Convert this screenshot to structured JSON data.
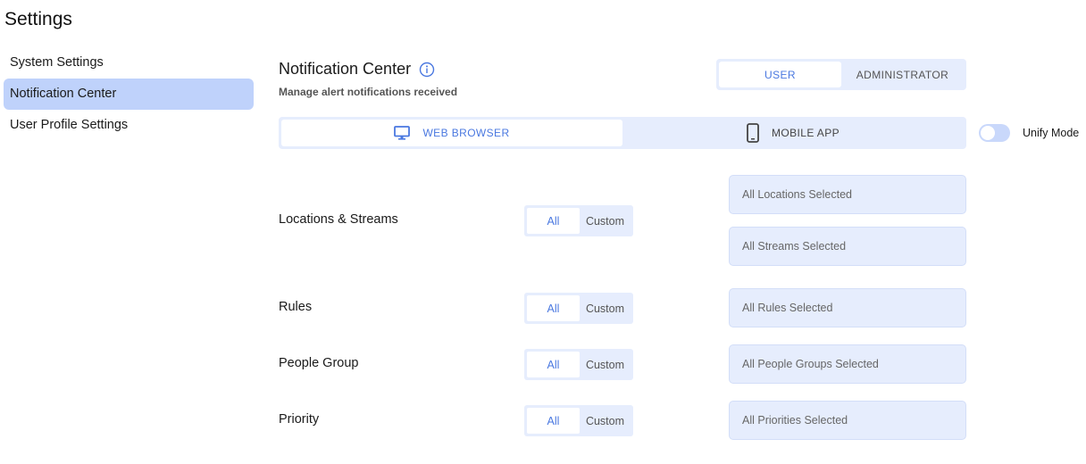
{
  "page": {
    "title": "Settings"
  },
  "sidebar": {
    "items": [
      {
        "label": "System Settings"
      },
      {
        "label": "Notification Center"
      },
      {
        "label": "User Profile Settings"
      }
    ]
  },
  "section": {
    "title": "Notification Center",
    "subtitle": "Manage alert notifications received"
  },
  "role_toggle": {
    "user": "USER",
    "administrator": "ADMINISTRATOR"
  },
  "platform_toggle": {
    "web": "WEB BROWSER",
    "mobile": "MOBILE APP"
  },
  "unify": {
    "label": "Unify Mode"
  },
  "rows": {
    "locations": {
      "label": "Locations & Streams",
      "all": "All",
      "custom": "Custom",
      "selects": [
        "All Locations Selected",
        "All Streams Selected"
      ]
    },
    "rules": {
      "label": "Rules",
      "all": "All",
      "custom": "Custom",
      "select": "All Rules Selected"
    },
    "people": {
      "label": "People Group",
      "all": "All",
      "custom": "Custom",
      "select": "All People Groups Selected"
    },
    "priority": {
      "label": "Priority",
      "all": "All",
      "custom": "Custom",
      "select": "All Priorities Selected"
    }
  },
  "colors": {
    "accent": "#4a78e0",
    "active_sidebar": "#bfd2fb",
    "panel": "#e6edfd"
  }
}
